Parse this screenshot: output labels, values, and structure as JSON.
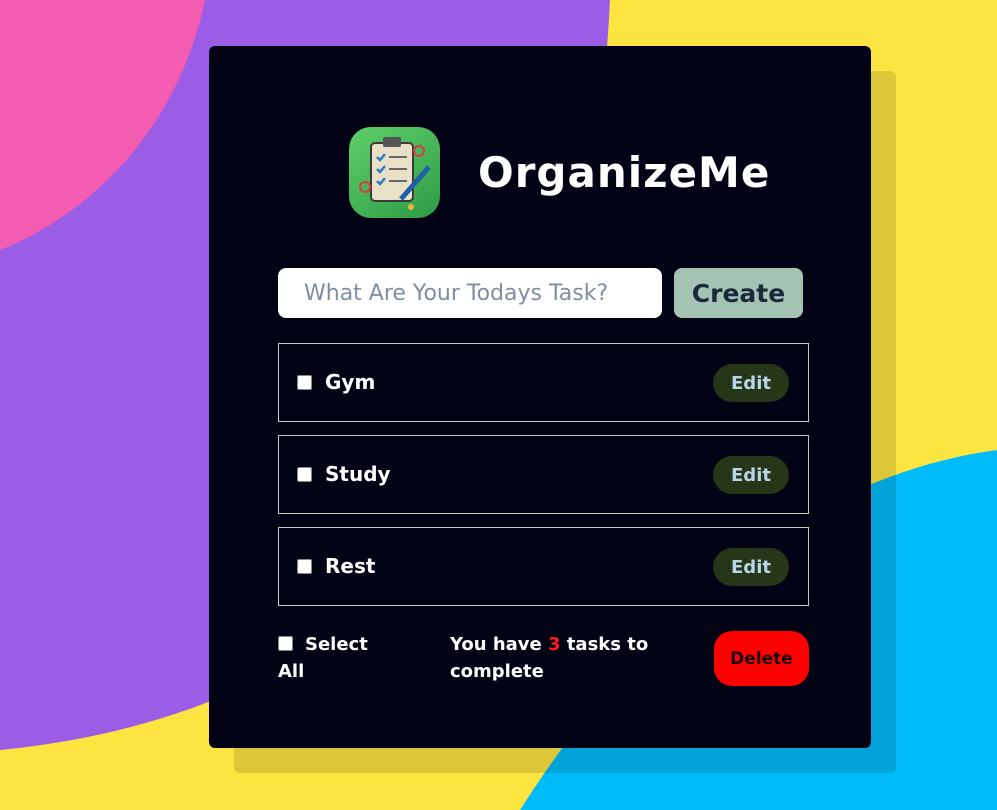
{
  "colors": {
    "pink": "#f35cb0",
    "purple": "#9b5de5",
    "yellow": "#fee440",
    "blue": "#00bbf9",
    "card": "#020314",
    "create_btn": "#a4c3b4",
    "edit_btn": "#263618",
    "delete_btn": "#ff0000"
  },
  "app": {
    "title": "OrganizeMe",
    "logo_icon": "clipboard-checklist-icon"
  },
  "input": {
    "placeholder": "What Are Your Todays Task?",
    "value": "",
    "create_label": "Create"
  },
  "tasks": [
    {
      "label": "Gym",
      "checked": false,
      "edit_label": "Edit"
    },
    {
      "label": "Study",
      "checked": false,
      "edit_label": "Edit"
    },
    {
      "label": "Rest",
      "checked": false,
      "edit_label": "Edit"
    }
  ],
  "footer": {
    "select_all_label": "Select All",
    "summary_prefix": "You have",
    "summary_count": "3",
    "summary_suffix": "tasks to complete",
    "delete_label": "Delete"
  }
}
